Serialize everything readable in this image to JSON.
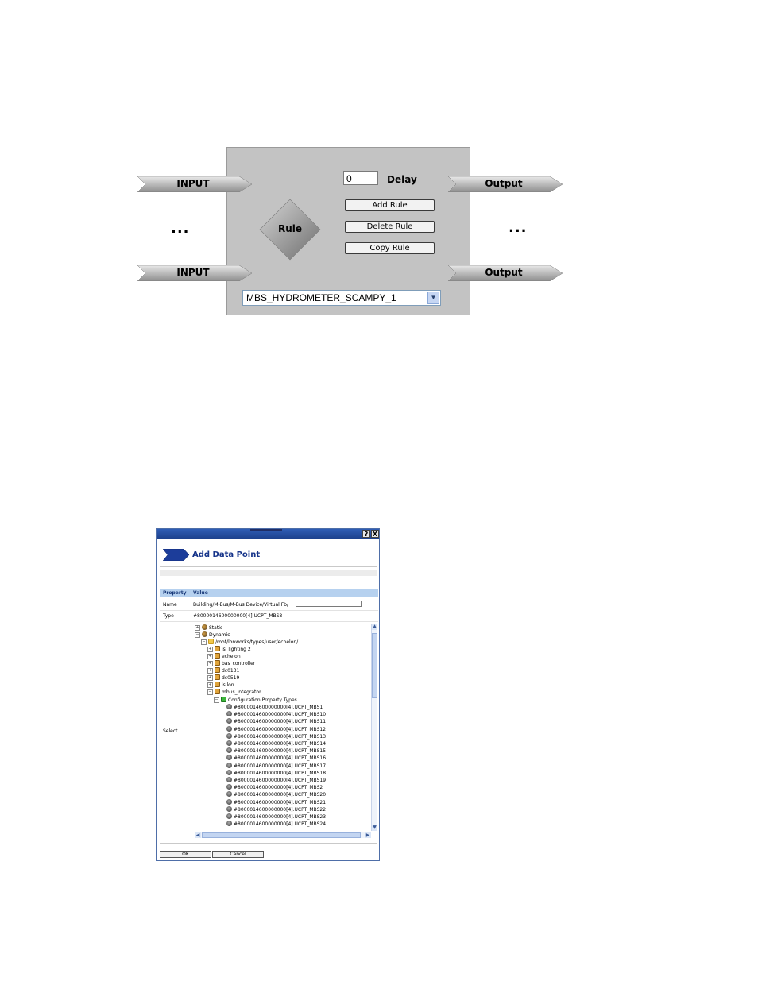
{
  "rule_block": {
    "inputs": [
      "INPUT",
      "INPUT"
    ],
    "outputs": [
      "Output",
      "Output"
    ],
    "ellipsis": "...",
    "rule_label": "Rule",
    "delay_value": "0",
    "delay_label": "Delay",
    "buttons": {
      "add": "Add Rule",
      "delete": "Delete Rule",
      "copy": "Copy Rule"
    },
    "selected_block": "MBS_HYDROMETER_SCAMPY_1",
    "panel_color": "#c3c3c3"
  },
  "dialog": {
    "title": "Add Data Point",
    "title_bar_buttons": {
      "help": "?",
      "close": "X"
    },
    "columns": {
      "property": "Property",
      "value": "Value"
    },
    "name": {
      "label": "Name",
      "value": "Building/M-Bus/M-Bus Device/Virtual Fb/"
    },
    "type": {
      "label": "Type",
      "value": "#8000014600000000[4].UCPT_MBS8"
    },
    "select_label": "Select",
    "tree": {
      "static": "Static",
      "dynamic": "Dynamic",
      "root_path": "/root/lonworks/types/user/echelon/",
      "packages": [
        "isi lighting 2",
        "echelon",
        "bas_controller",
        "dc0131",
        "dc0519",
        "isilon",
        "mbus_integrator"
      ],
      "cp_types": "Configuration Property Types",
      "items": [
        "#8000014600000000[4].UCPT_MBS1",
        "#8000014600000000[4].UCPT_MBS10",
        "#8000014600000000[4].UCPT_MBS11",
        "#8000014600000000[4].UCPT_MBS12",
        "#8000014600000000[4].UCPT_MBS13",
        "#8000014600000000[4].UCPT_MBS14",
        "#8000014600000000[4].UCPT_MBS15",
        "#8000014600000000[4].UCPT_MBS16",
        "#8000014600000000[4].UCPT_MBS17",
        "#8000014600000000[4].UCPT_MBS18",
        "#8000014600000000[4].UCPT_MBS19",
        "#8000014600000000[4].UCPT_MBS2",
        "#8000014600000000[4].UCPT_MBS20",
        "#8000014600000000[4].UCPT_MBS21",
        "#8000014600000000[4].UCPT_MBS22",
        "#8000014600000000[4].UCPT_MBS23",
        "#8000014600000000[4].UCPT_MBS24"
      ]
    },
    "buttons": {
      "ok": "OK",
      "cancel": "Cancel"
    },
    "accent_color": "#16348a",
    "header_color": "#b6d1ef"
  }
}
